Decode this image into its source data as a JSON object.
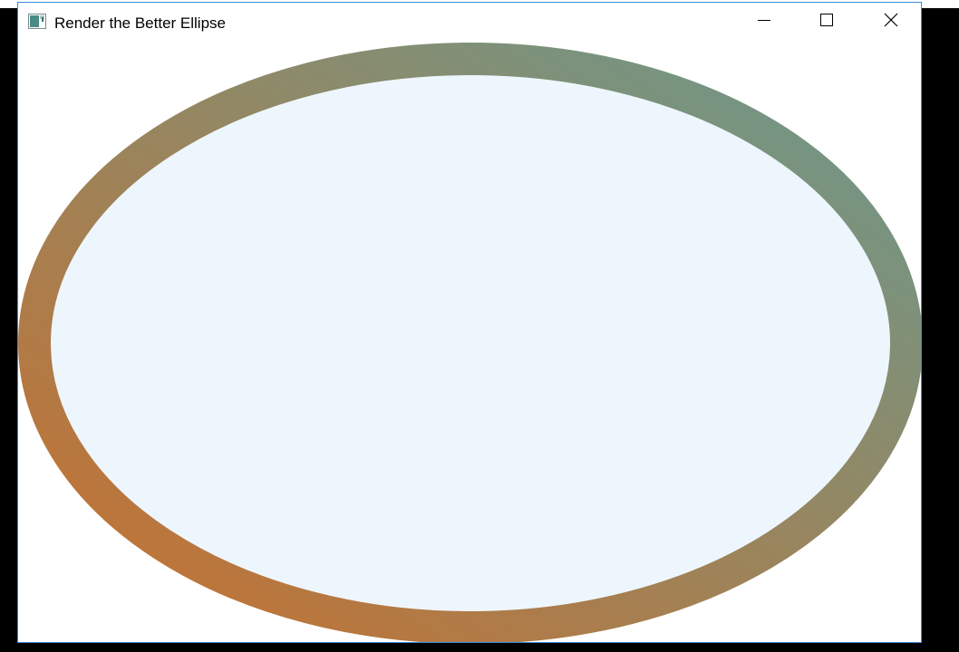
{
  "window": {
    "title": "Render the Better Ellipse"
  },
  "titlebar_buttons": {
    "minimize_icon": "minimize-icon",
    "maximize_icon": "maximize-icon",
    "close_icon": "close-icon"
  },
  "ellipse": {
    "fill_color": "#eef6fd",
    "stroke_gradient_start": "#c8702e",
    "stroke_gradient_end": "#6a9a8e"
  },
  "colors": {
    "window_border": "#3c8ad8",
    "background_outside": "#000000",
    "window_background": "#ffffff"
  }
}
